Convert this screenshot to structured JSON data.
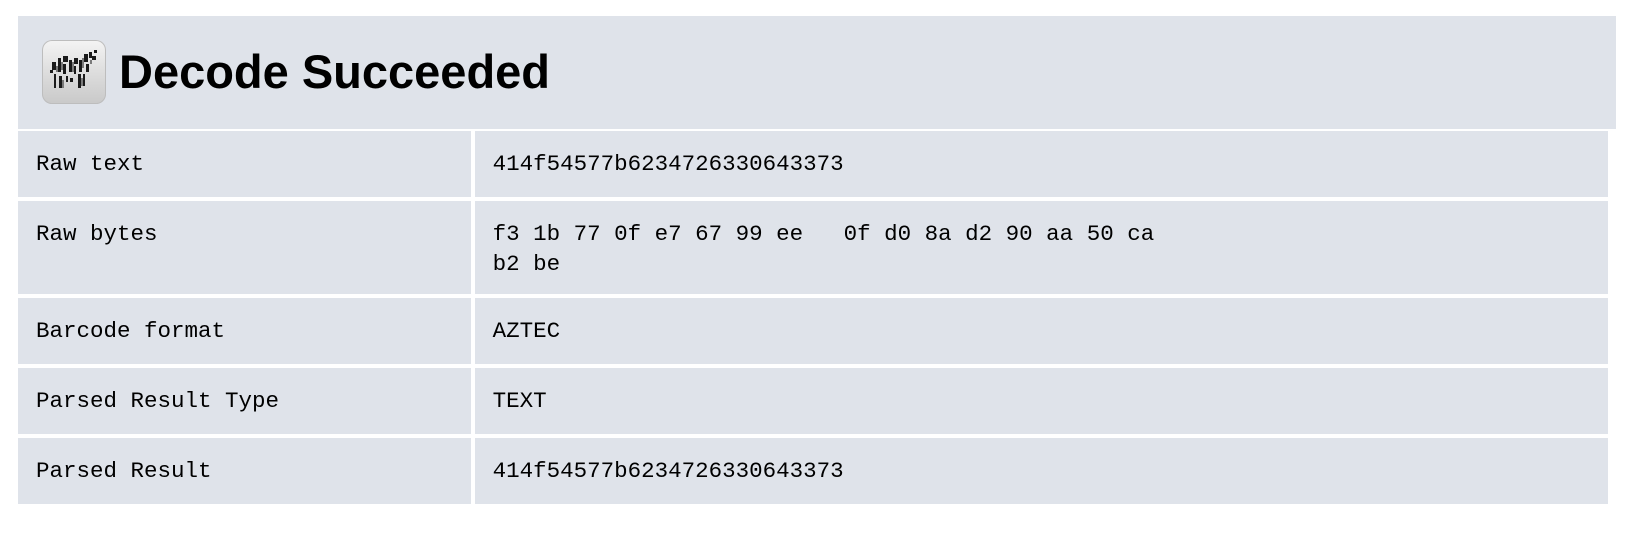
{
  "header": {
    "title": "Decode Succeeded",
    "logo_icon": "zebra-barcode-logo-icon"
  },
  "colors": {
    "panel_background": "#dfe3ea",
    "page_background": "#ffffff",
    "text": "#000000"
  },
  "results": {
    "raw_text": {
      "label": "Raw text",
      "value": "414f54577b6234726330643373"
    },
    "raw_bytes": {
      "label": "Raw bytes",
      "line1": "f3 1b 77 0f e7 67 99 ee   0f d0 8a d2 90 aa 50 ca",
      "line2": "b2 be"
    },
    "barcode_format": {
      "label": "Barcode format",
      "value": "AZTEC"
    },
    "parsed_result_type": {
      "label": "Parsed Result Type",
      "value": "TEXT"
    },
    "parsed_result": {
      "label": "Parsed Result",
      "value": "414f54577b6234726330643373"
    }
  }
}
